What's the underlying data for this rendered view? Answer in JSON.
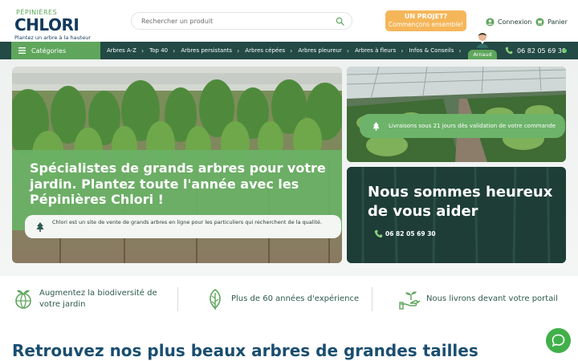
{
  "logo": {
    "top": "PÉPINIÈRES",
    "main": "CHLORI",
    "tagline": "Plantez un arbre à la hauteur"
  },
  "search": {
    "placeholder": "Rechercher un produit"
  },
  "project_button": {
    "line1": "UN PROJET?",
    "line2": "Commençons ensemble!"
  },
  "header_links": {
    "login": "Connexion",
    "cart": "Panier"
  },
  "nav": {
    "categories_label": "Catégories",
    "items": [
      {
        "label": "Arbres A-Z"
      },
      {
        "label": "Top 40"
      },
      {
        "label": "Arbres persistants"
      },
      {
        "label": "Arbres cépées"
      },
      {
        "label": "Arbres pleureur"
      },
      {
        "label": "Arbres à fleurs"
      },
      {
        "label": "Infos & Conseils"
      }
    ],
    "advisor_name": "Arnaud",
    "phone": "06 82 05 69 30"
  },
  "hero": {
    "title": "Spécialistes de grands arbres pour votre jardin. Plantez toute l'année avec les Pépinières Chlori !",
    "description": "Chlori est un site de vente de grands arbres en ligne pour les particuliers qui recherchent de la qualité.",
    "delivery": "Livraisons sous 21 jours dès validation de votre commande",
    "help_title": "Nous sommes heureux de vous aider",
    "help_phone": "06 82 05 69 30"
  },
  "features": [
    {
      "text": "Augmentez la biodiversité de votre jardin",
      "icon": "globe-leaf-icon"
    },
    {
      "text": "Plus de 60 années d'expérience",
      "icon": "leaf-icon"
    },
    {
      "text": "Nous livrons devant votre portail",
      "icon": "hand-plant-icon"
    }
  ],
  "section": {
    "title": "Retrouvez nos plus beaux arbres de grandes tailles"
  },
  "colors": {
    "brand_green": "#5fa65c",
    "nav_dark": "#234a45",
    "accent_orange": "#f5b65a",
    "navy": "#1a4e70"
  }
}
